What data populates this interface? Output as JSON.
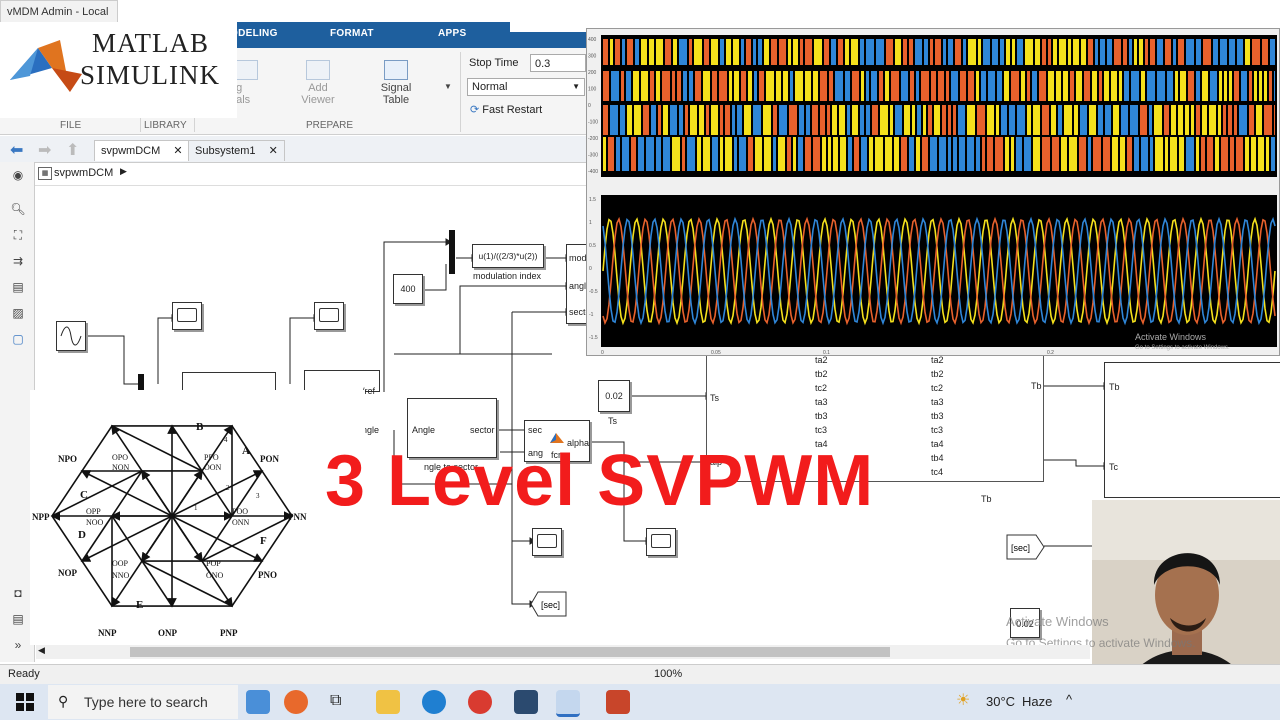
{
  "window": {
    "title": "vMDM Admin - Local"
  },
  "ribbon": {
    "tabs": [
      "ODELING",
      "FORMAT",
      "APPS"
    ],
    "buttons": {
      "signals": "og\nnals",
      "add_viewer_1": "Add",
      "add_viewer_2": "Viewer",
      "signal_table_1": "Signal",
      "signal_table_2": "Table"
    },
    "sections": {
      "file": "FILE",
      "library": "LIBRARY",
      "prepare": "PREPARE"
    },
    "stop_time_label": "Stop Time",
    "stop_time_value": "0.3",
    "sim_mode": "Normal",
    "fast_restart": "Fast Restart"
  },
  "nav": {
    "tabs": [
      "svpwmDCM",
      "Subsystem1"
    ],
    "address": "svpwmDCM"
  },
  "diagram": {
    "const_400": "400",
    "fcn_mod": "u(1)/((2/3)*u(2))",
    "lbl_modindex": "modulation index",
    "port_mod": "mod",
    "port_angle": "angle",
    "port_sector": "sector",
    "ref_lbl": "/ref",
    "ngle_lbl": "ngle",
    "angle_in": "Angle",
    "sector_out": "sector",
    "angle_to_sector": "ngle to sector",
    "fcn_sec": "sec",
    "fcn_ang": "ang",
    "fcn_alpha": "alpha",
    "fcn_name": "fcn",
    "ts_val": "0.02",
    "ts_lbl": "Ts",
    "ts_port": "Ts",
    "alpha_port": "alp",
    "sub_in": [
      "ta2",
      "tb2",
      "tc2",
      "ta3",
      "tb3",
      "tc3",
      "ta4"
    ],
    "sub_out": [
      "ta2",
      "tb2",
      "tc2",
      "ta3",
      "tb3",
      "tc3",
      "ta4",
      "tb4",
      "tc4"
    ],
    "sub_tb_right": "Tb",
    "sub_tb_bottom": "Tb",
    "out_tb": "Tb",
    "out_tc": "Tc",
    "goto_sec": "[sec]",
    "from_sec": "[sec]",
    "const_002b": "0.02"
  },
  "scope": {
    "top_yticks": [
      "400",
      "300",
      "200",
      "100",
      "0",
      "-100",
      "-200",
      "-300",
      "-400"
    ],
    "bottom_yticks": [
      "1.5",
      "1",
      "0.5",
      "0",
      "-0.5",
      "-1",
      "-1.5"
    ],
    "xticks": [
      "0",
      "0.05",
      "0.1",
      "0.2"
    ],
    "activate1": "Activate Windows",
    "activate2": "Go to Settings to activate Windows."
  },
  "hexagon": {
    "vertices": [
      "NPO",
      "PON",
      "NPP",
      "PNN",
      "NOP",
      "PNO",
      "NNP",
      "ONP",
      "PNP"
    ],
    "inner": [
      "OPO",
      "NON",
      "PPO",
      "OON",
      "OPP",
      "NOO",
      "POO",
      "ONN",
      "OOP",
      "NNO",
      "POP",
      "ONO"
    ],
    "sectors": [
      "A",
      "B",
      "C",
      "D",
      "E",
      "F"
    ],
    "regions": [
      "1",
      "2",
      "3",
      "4"
    ]
  },
  "overlay": {
    "title": "3 Level SVPWM"
  },
  "logo": {
    "line1": "MATLAB",
    "line2": "SIMULINK"
  },
  "status": {
    "left": "Ready",
    "zoom": "100%"
  },
  "watermark": {
    "line1": "Activate Windows",
    "line2": "Go to Settings to activate Windows."
  },
  "taskbar": {
    "search": "Type here to search",
    "temp": "30°C",
    "weather": "Haze"
  },
  "colors": {
    "ribbon_blue": "#1e5f9e",
    "title_red": "#f21c1c",
    "scope_bg": "#000000",
    "trace_yellow": "#f5e11c",
    "trace_orange": "#e8612c",
    "trace_blue": "#2f86d8"
  }
}
